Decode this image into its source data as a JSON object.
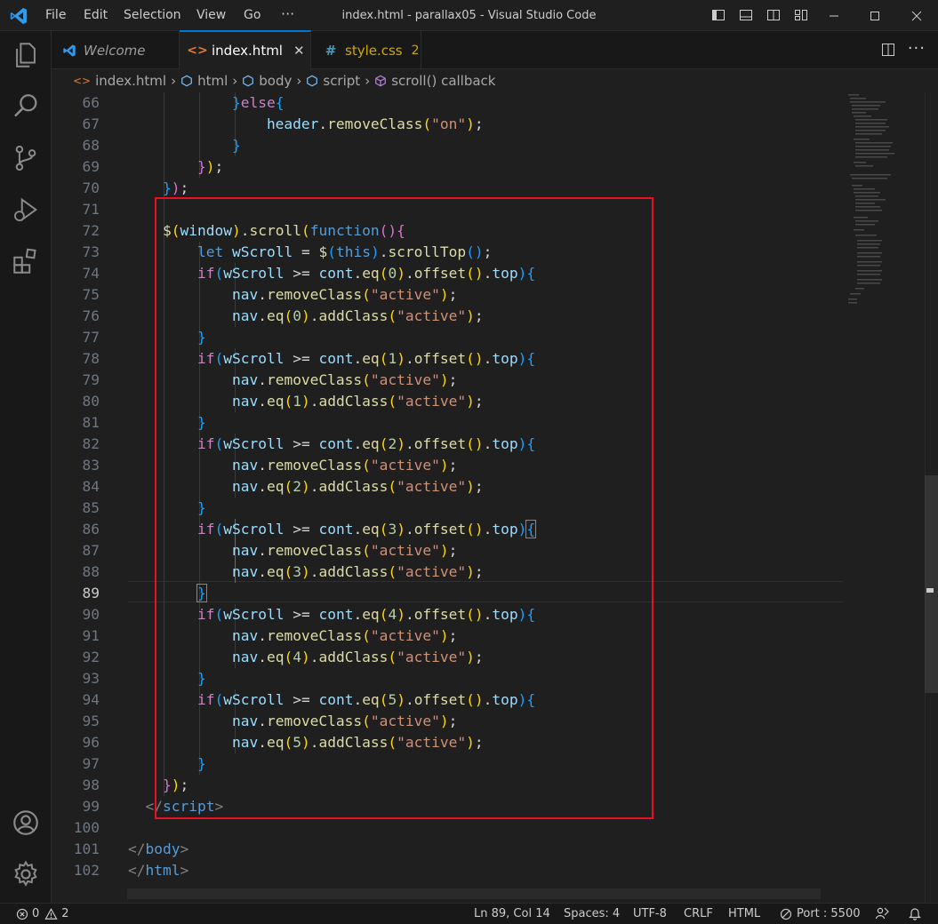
{
  "title": {
    "menu": [
      "File",
      "Edit",
      "Selection",
      "View",
      "Go"
    ],
    "more": "···",
    "window_title": "index.html - parallax05 - Visual Studio Code"
  },
  "tabs": [
    {
      "label": "Welcome",
      "icon": "vscode-icon",
      "active": false,
      "italic": true
    },
    {
      "label": "index.html",
      "icon": "html-icon",
      "active": true,
      "close": "✕"
    },
    {
      "label": "style.css",
      "icon": "css-icon",
      "active": false,
      "badge": "2"
    }
  ],
  "breadcrumb": [
    "index.html",
    "html",
    "body",
    "script",
    "scroll() callback"
  ],
  "editor": {
    "current_line": 89,
    "line_numbers": [
      "66",
      "67",
      "68",
      "69",
      "70",
      "71",
      "72",
      "73",
      "74",
      "75",
      "76",
      "77",
      "78",
      "79",
      "80",
      "81",
      "82",
      "83",
      "84",
      "85",
      "86",
      "87",
      "88",
      "89",
      "90",
      "91",
      "92",
      "93",
      "94",
      "95",
      "96",
      "97",
      "98",
      "99",
      "100",
      "101",
      "102"
    ]
  },
  "statusbar": {
    "errors": "0",
    "warnings": "2",
    "position": "Ln 89, Col 14",
    "spaces": "Spaces: 4",
    "encoding": "UTF-8",
    "eol": "CRLF",
    "language": "HTML",
    "port": "Port : 5500"
  },
  "colors": {
    "accent": "#0078d4",
    "highlight_box": "#e81123",
    "html_icon": "#e37933",
    "css_icon": "#519aba",
    "warning_badge": "#cca700"
  }
}
